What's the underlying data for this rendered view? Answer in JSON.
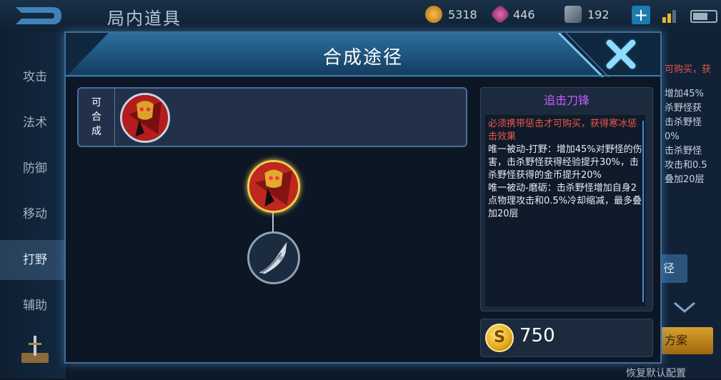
{
  "topbar": {
    "title": "局内道具",
    "gold": "5318",
    "gems": "446",
    "tickets": "192",
    "plus_label": "+"
  },
  "sidebar": {
    "items": [
      {
        "label": "攻击"
      },
      {
        "label": "法术"
      },
      {
        "label": "防御"
      },
      {
        "label": "移动"
      },
      {
        "label": "打野"
      },
      {
        "label": "辅助"
      }
    ],
    "active": "打野"
  },
  "background_right": {
    "line1": "可购买，获",
    "lines": "增加45%\n杀野怪获\n击杀野怪\n0%\n击杀野怪\n攻击和0.5\n叠加20层",
    "button_label": "径",
    "yellow_button_label": "方案",
    "bottom_text": "恢复默认配置"
  },
  "modal": {
    "title": "合成途径",
    "close_icon": "close-x-icon",
    "recipe_label": [
      "可",
      "合",
      "成"
    ],
    "recipe_item_icon": "golden-mask-blade-icon",
    "tree_parent_icon": "chasing-blade-icon",
    "tree_child_icon": "punishment-blade-icon",
    "item_name": "追击刀锋",
    "requirement": "必须携带惩击才可购买，获得寒冰惩击效果",
    "passive1": "唯一被动-打野：增加45%对野怪的伤害，击杀野怪获得经验提升30%，击杀野怪获得的金币提升20%",
    "passive2": "唯一被动-磨砺：击杀野怪增加自身2点物理攻击和0.5%冷却缩减，最多叠加20层",
    "price": "750",
    "coin_symbol": "S"
  },
  "colors": {
    "item_name": "#c85cff",
    "requirement": "#f0574a",
    "accent_gold": "#f2cd4e",
    "modal_border": "#3f6e96"
  }
}
